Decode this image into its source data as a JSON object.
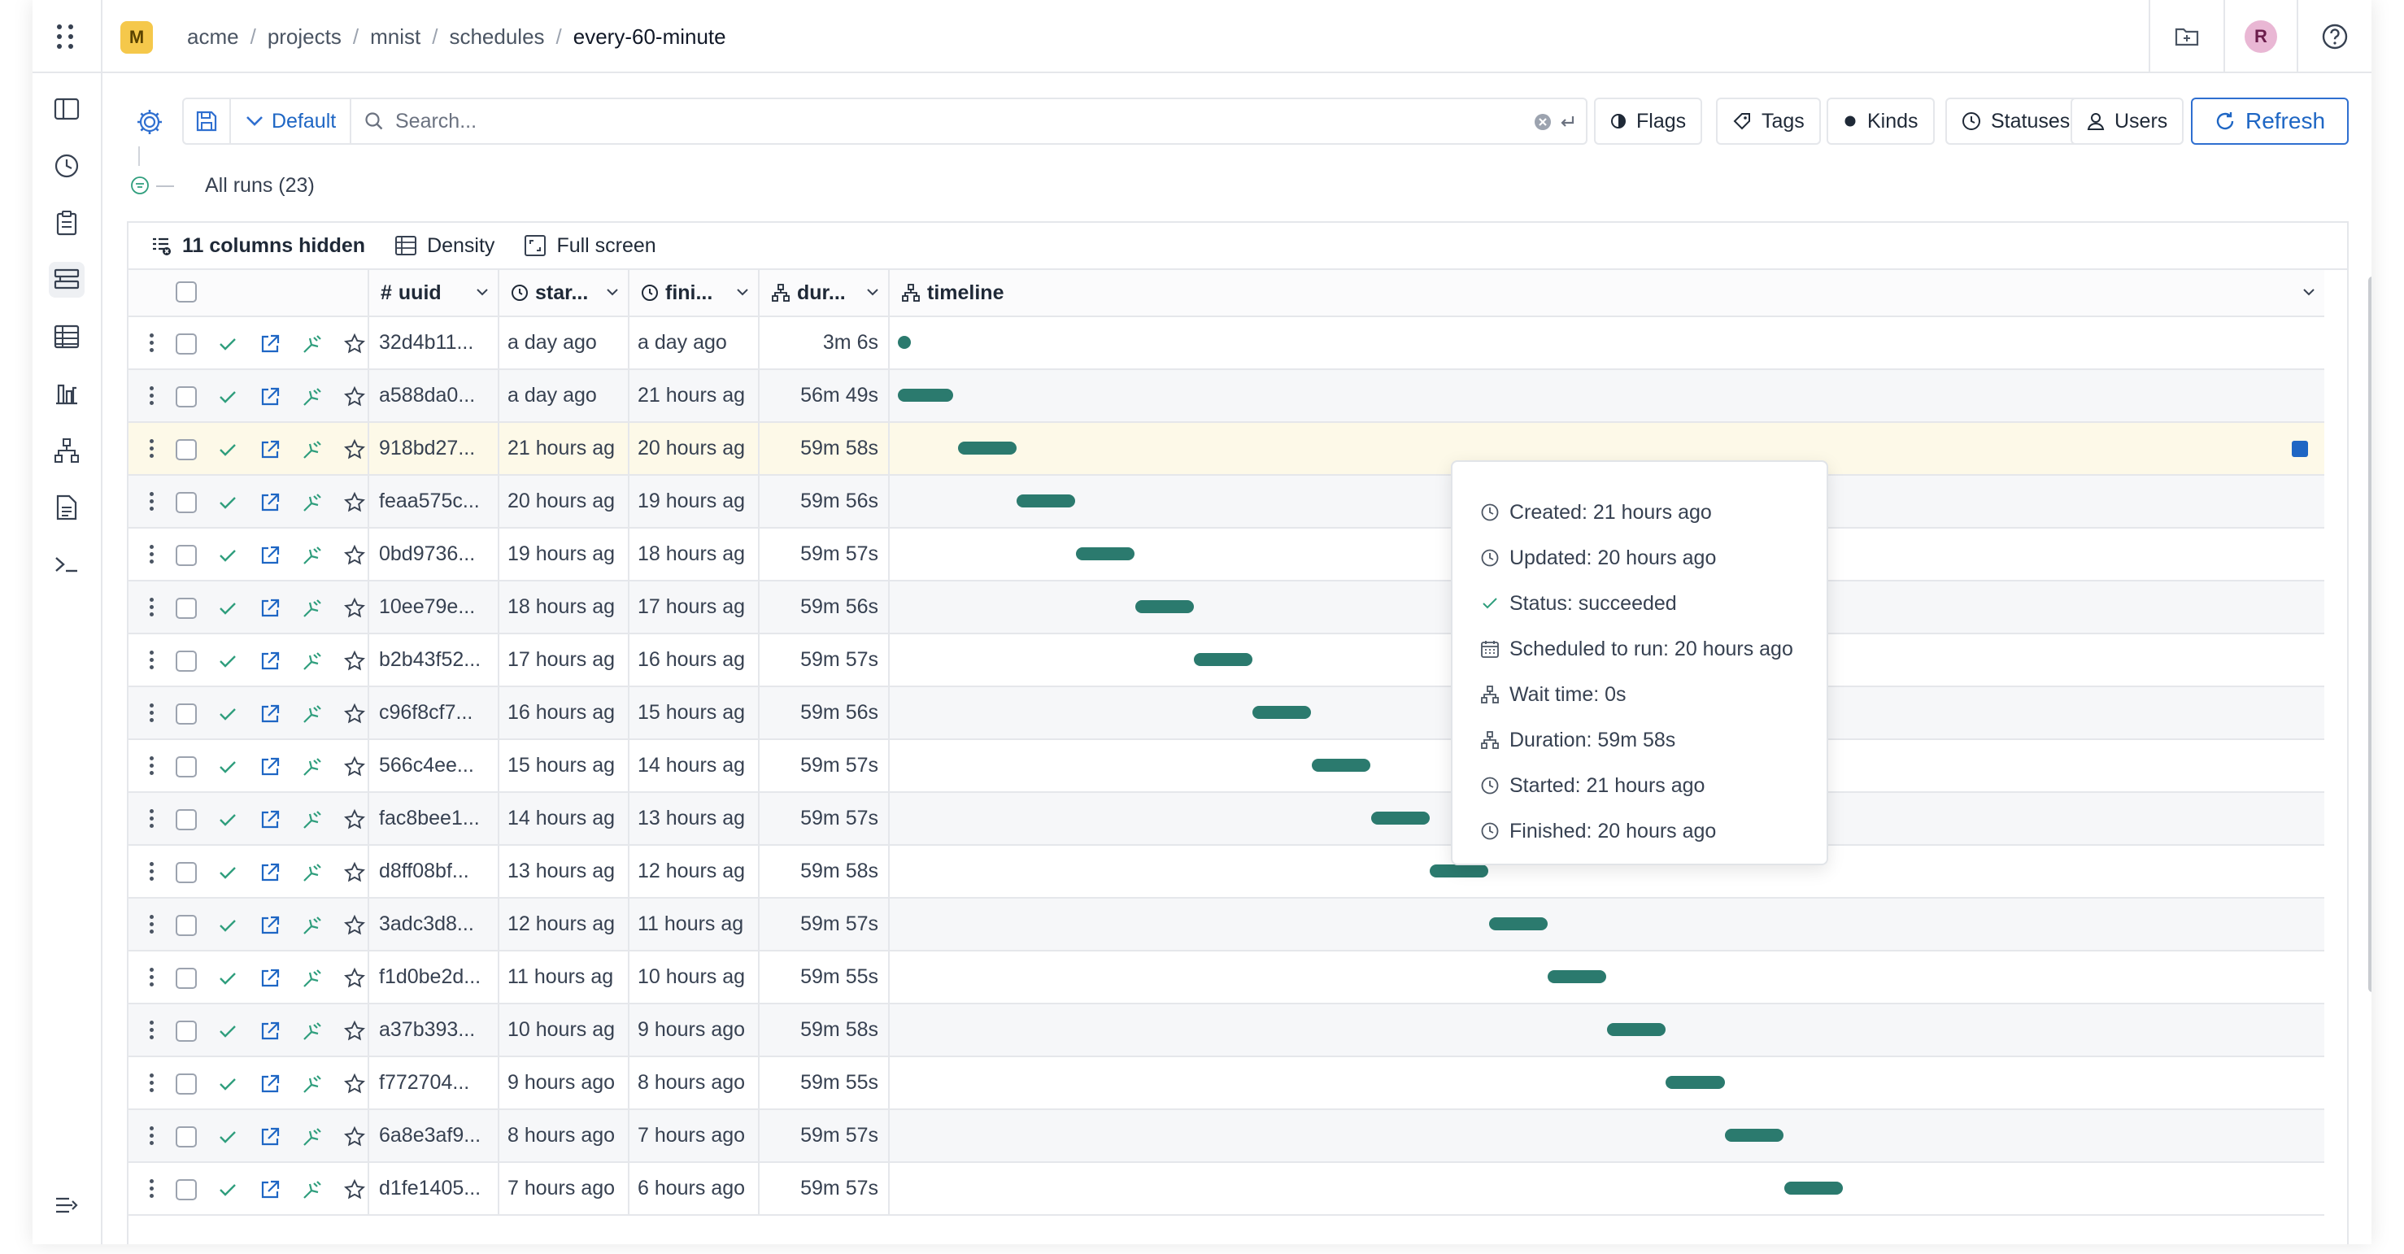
{
  "topbar": {
    "org_initial": "M",
    "breadcrumb": [
      "acme",
      "projects",
      "mnist",
      "schedules",
      "every-60-minute"
    ],
    "user_initial": "R"
  },
  "toolbar": {
    "preset_label": "Default",
    "search_placeholder": "Search...",
    "filters": [
      "Flags",
      "Tags",
      "Kinds",
      "Statuses",
      "Users"
    ],
    "refresh_label": "Refresh",
    "runs_label": "All runs (23)"
  },
  "table_tools": {
    "hidden_columns": "11 columns hidden",
    "density": "Density",
    "fullscreen": "Full screen"
  },
  "columns": {
    "uuid": "uuid",
    "started": "star...",
    "finished": "fini...",
    "duration": "dur...",
    "timeline": "timeline"
  },
  "rows": [
    {
      "uuid": "32d4b11...",
      "started": "a day ago",
      "finished": "a day ago",
      "duration": "3m 6s",
      "timeline_start": 0.0,
      "timeline_length": 0.0
    },
    {
      "uuid": "a588da0...",
      "started": "a day ago",
      "finished": "21 hours ag",
      "duration": "56m 49s",
      "timeline_start": 0.001,
      "timeline_length": 0.88
    },
    {
      "uuid": "918bd27...",
      "started": "21 hours ag",
      "finished": "20 hours ag",
      "duration": "59m 58s",
      "timeline_start": 0.95,
      "timeline_length": 0.93
    },
    {
      "uuid": "feaa575c...",
      "started": "20 hours ag",
      "finished": "19 hours ag",
      "duration": "59m 56s",
      "timeline_start": 1.88,
      "timeline_length": 0.93
    },
    {
      "uuid": "0bd9736...",
      "started": "19 hours ag",
      "finished": "18 hours ag",
      "duration": "59m 57s",
      "timeline_start": 2.82,
      "timeline_length": 0.93
    },
    {
      "uuid": "10ee79e...",
      "started": "18 hours ag",
      "finished": "17 hours ag",
      "duration": "59m 56s",
      "timeline_start": 3.76,
      "timeline_length": 0.93
    },
    {
      "uuid": "b2b43f52...",
      "started": "17 hours ag",
      "finished": "16 hours ag",
      "duration": "59m 57s",
      "timeline_start": 4.69,
      "timeline_length": 0.93
    },
    {
      "uuid": "c96f8cf7...",
      "started": "16 hours ag",
      "finished": "15 hours ag",
      "duration": "59m 56s",
      "timeline_start": 5.62,
      "timeline_length": 0.93
    },
    {
      "uuid": "566c4ee...",
      "started": "15 hours ag",
      "finished": "14 hours ag",
      "duration": "59m 57s",
      "timeline_start": 6.56,
      "timeline_length": 0.93
    },
    {
      "uuid": "fac8bee1...",
      "started": "14 hours ag",
      "finished": "13 hours ag",
      "duration": "59m 57s",
      "timeline_start": 7.5,
      "timeline_length": 0.93
    },
    {
      "uuid": "d8ff08bf...",
      "started": "13 hours ag",
      "finished": "12 hours ag",
      "duration": "59m 58s",
      "timeline_start": 8.43,
      "timeline_length": 0.93
    },
    {
      "uuid": "3adc3d8...",
      "started": "12 hours ag",
      "finished": "11 hours ag",
      "duration": "59m 57s",
      "timeline_start": 9.37,
      "timeline_length": 0.93
    },
    {
      "uuid": "f1d0be2d...",
      "started": "11 hours ag",
      "finished": "10 hours ag",
      "duration": "59m 55s",
      "timeline_start": 10.3,
      "timeline_length": 0.93
    },
    {
      "uuid": "a37b393...",
      "started": "10 hours ag",
      "finished": "9 hours ago",
      "duration": "59m 58s",
      "timeline_start": 11.24,
      "timeline_length": 0.93
    },
    {
      "uuid": "f772704...",
      "started": "9 hours ago",
      "finished": "8 hours ago",
      "duration": "59m 55s",
      "timeline_start": 12.17,
      "timeline_length": 0.93
    },
    {
      "uuid": "6a8e3af9...",
      "started": "8 hours ago",
      "finished": "7 hours ago",
      "duration": "59m 57s",
      "timeline_start": 13.11,
      "timeline_length": 0.93
    },
    {
      "uuid": "d1fe1405...",
      "started": "7 hours ago",
      "finished": "6 hours ago",
      "duration": "59m 57s",
      "timeline_start": 14.04,
      "timeline_length": 0.93
    }
  ],
  "tooltip": {
    "created": "Created: 21 hours ago",
    "updated": "Updated: 20 hours ago",
    "status": "Status: succeeded",
    "scheduled": "Scheduled to run: 20 hours ago",
    "wait": "Wait time: 0s",
    "duration": "Duration: 59m 58s",
    "started": "Started: 21 hours ago",
    "finished": "Finished: 20 hours ago"
  },
  "colors": {
    "accent": "#1e66c4",
    "status_success": "#2f9e7d",
    "timeline_bar": "#2b7a6e",
    "highlight_row": "#fdf9e8"
  }
}
